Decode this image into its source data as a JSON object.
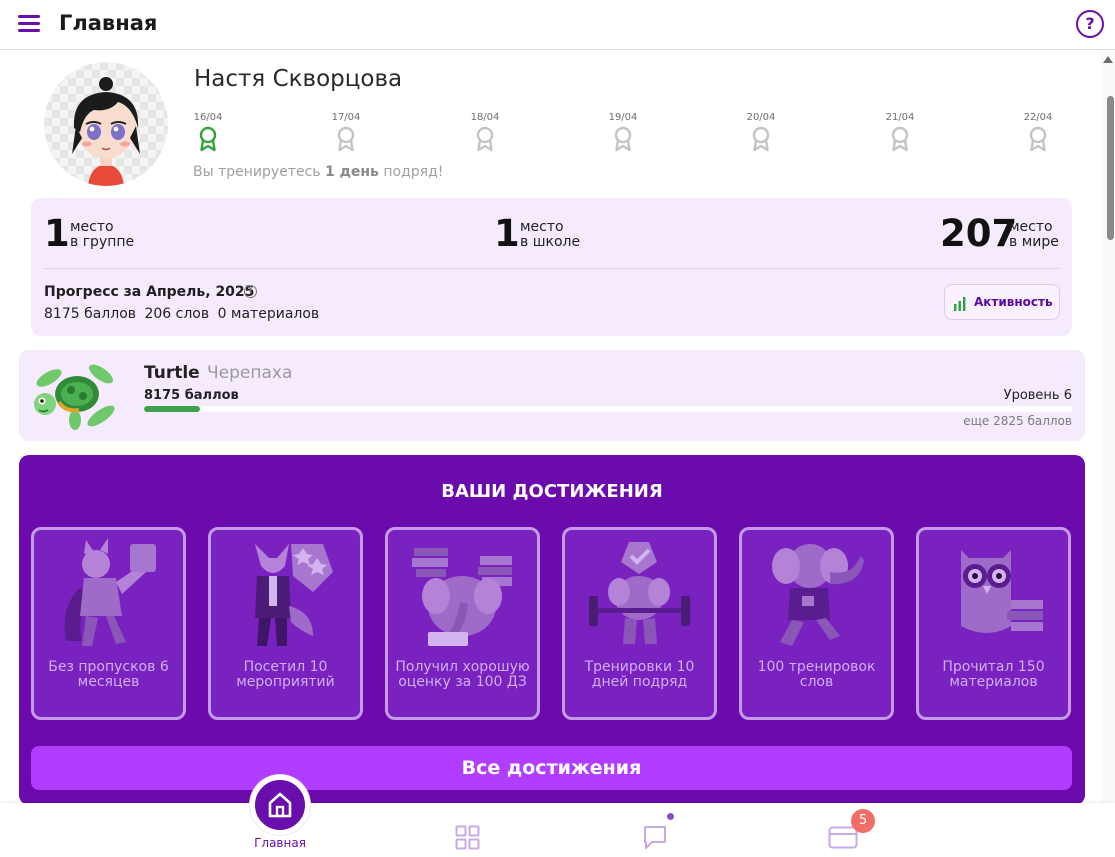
{
  "header": {
    "title": "Главная",
    "menu_icon": "hamburger-menu-icon",
    "help_icon": "help-circle-icon",
    "help_glyph": "?"
  },
  "profile": {
    "name": "Настя Скворцова",
    "days": [
      {
        "date": "16/04",
        "achieved": true
      },
      {
        "date": "17/04",
        "achieved": false
      },
      {
        "date": "18/04",
        "achieved": false
      },
      {
        "date": "19/04",
        "achieved": false
      },
      {
        "date": "20/04",
        "achieved": false
      },
      {
        "date": "21/04",
        "achieved": false
      },
      {
        "date": "22/04",
        "achieved": false
      }
    ],
    "streak_prefix": "Вы тренируетесь ",
    "streak_bold": "1 день",
    "streak_suffix": " подряд!"
  },
  "ranks": {
    "group": {
      "value": "1",
      "line1": "место",
      "line2": "в группе"
    },
    "school": {
      "value": "1",
      "line1": "место",
      "line2": "в школе"
    },
    "world": {
      "value": "207",
      "line1": "место",
      "line2": "в мире"
    }
  },
  "progress": {
    "title": "Прогресс за Апрель, 2025",
    "info_glyph": "i",
    "points": "8175 баллов",
    "words": "206 слов",
    "materials": "0 материалов",
    "activity_label": "Активность"
  },
  "level": {
    "name": "Turtle",
    "name_ru": "Черепаха",
    "points": "8175 баллов",
    "level_label": "Уровень 6",
    "remaining": "еще 2825 баллов",
    "progress_fraction": 0.06
  },
  "achievements": {
    "title": "ВАШИ ДОСТИЖЕНИЯ",
    "items": [
      {
        "label": "Без пропусков 6 месяцев",
        "icon": "hero-cat-icon"
      },
      {
        "label": "Посетил 10 мероприятий",
        "icon": "fox-backpack-icon"
      },
      {
        "label": "Получил хорошую оценку за 100 ДЗ",
        "icon": "elephant-books-icon"
      },
      {
        "label": "Тренировки 10 дней подряд",
        "icon": "elephant-barbell-icon"
      },
      {
        "label": "100 тренировок слов",
        "icon": "elephant-walking-icon"
      },
      {
        "label": "Прочитал 150 материалов",
        "icon": "owl-books-icon"
      }
    ],
    "all_button": "Все достижения"
  },
  "bottom_nav": {
    "home_label": "Главная",
    "badge_count": "5"
  },
  "colors": {
    "accent": "#6a0dad",
    "card_bg": "#f6ebfd",
    "button": "#b03dff",
    "progress": "#3ca24a",
    "badge": "#f16d6a"
  }
}
